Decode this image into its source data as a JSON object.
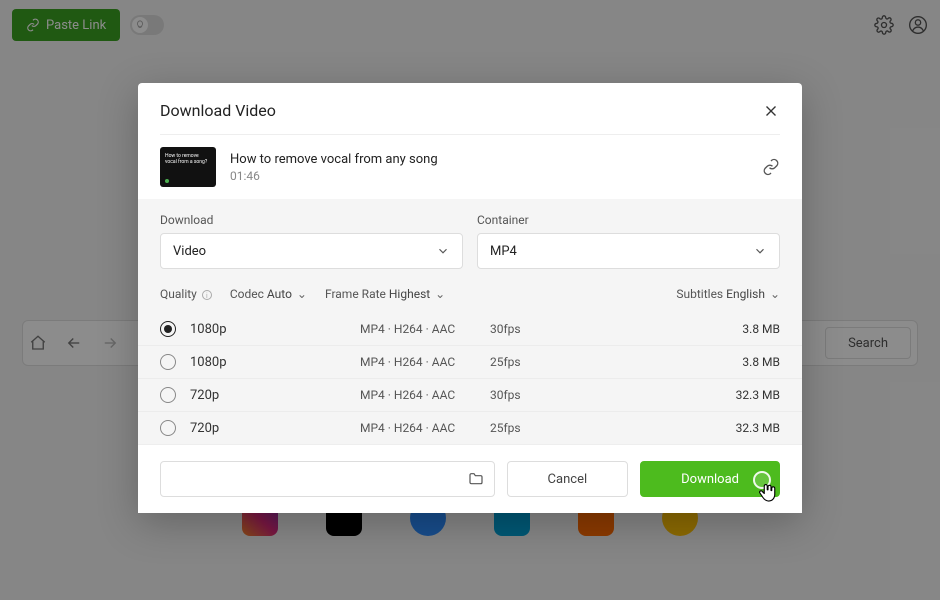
{
  "toolbar": {
    "paste_label": "Paste Link"
  },
  "browser_bar": {
    "search_label": "Search"
  },
  "modal": {
    "title": "Download Video",
    "video": {
      "title": "How to remove vocal from any song",
      "duration": "01:46",
      "thumb_text": "How to remove vocal from a song?"
    },
    "download_select": {
      "label": "Download",
      "value": "Video"
    },
    "container_select": {
      "label": "Container",
      "value": "MP4"
    },
    "filters": {
      "quality_label": "Quality",
      "codec_label": "Codec",
      "codec_value": "Auto",
      "framerate_label": "Frame Rate",
      "framerate_value": "Highest",
      "subtitles_label": "Subtitles",
      "subtitles_value": "English"
    },
    "qualities": [
      {
        "res": "1080p",
        "codec": "MP4 · H264 · AAC",
        "fps": "30fps",
        "size": "3.8 MB",
        "selected": true
      },
      {
        "res": "1080p",
        "codec": "MP4 · H264 · AAC",
        "fps": "25fps",
        "size": "3.8 MB",
        "selected": false
      },
      {
        "res": "720p",
        "codec": "MP4 · H264 · AAC",
        "fps": "30fps",
        "size": "32.3 MB",
        "selected": false
      },
      {
        "res": "720p",
        "codec": "MP4 · H264 · AAC",
        "fps": "25fps",
        "size": "32.3 MB",
        "selected": false
      }
    ],
    "footer": {
      "cancel_label": "Cancel",
      "download_label": "Download"
    }
  },
  "colors": {
    "primary_green": "#4dbb1e",
    "paste_green": "#3ba321"
  }
}
